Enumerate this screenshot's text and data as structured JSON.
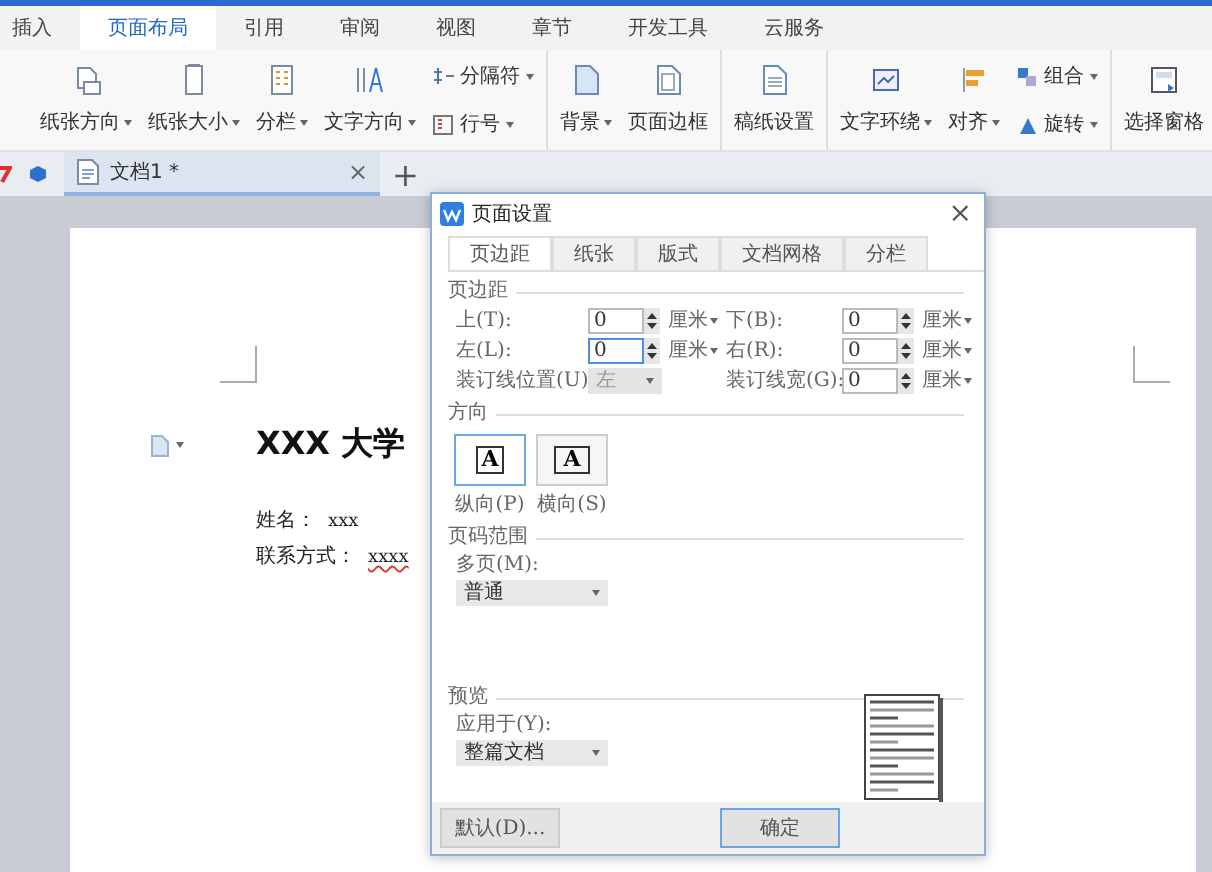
{
  "ribbon_tabs": [
    {
      "label": "插入",
      "selected": false
    },
    {
      "label": "页面布局",
      "selected": true
    },
    {
      "label": "引用",
      "selected": false
    },
    {
      "label": "审阅",
      "selected": false
    },
    {
      "label": "视图",
      "selected": false
    },
    {
      "label": "章节",
      "selected": false
    },
    {
      "label": "开发工具",
      "selected": false
    },
    {
      "label": "云服务",
      "selected": false
    }
  ],
  "ribbon_groups": [
    [
      {
        "kind": "large",
        "label": "纸张方向",
        "dropdown": true
      },
      {
        "kind": "large",
        "label": "纸张大小",
        "dropdown": true
      },
      {
        "kind": "large",
        "label": "分栏",
        "dropdown": true
      },
      {
        "kind": "large",
        "label": "文字方向",
        "dropdown": true
      },
      {
        "kind": "stack",
        "rows": [
          {
            "label": "分隔符",
            "dropdown": true
          },
          {
            "label": "行号",
            "dropdown": true
          }
        ]
      }
    ],
    [
      {
        "kind": "large",
        "label": "背景",
        "dropdown": true
      },
      {
        "kind": "large",
        "label": "页面边框",
        "dropdown": false
      }
    ],
    [
      {
        "kind": "large",
        "label": "稿纸设置",
        "dropdown": false
      }
    ],
    [
      {
        "kind": "large",
        "label": "文字环绕",
        "dropdown": true
      },
      {
        "kind": "large",
        "label": "对齐",
        "dropdown": true
      },
      {
        "kind": "stack",
        "rows": [
          {
            "label": "组合",
            "dropdown": true
          },
          {
            "label": "旋转",
            "dropdown": true
          }
        ]
      }
    ],
    [
      {
        "kind": "large",
        "label": "选择窗格",
        "dropdown": false
      }
    ]
  ],
  "doc_tabs": [
    {
      "label": "文档1 *",
      "selected": true,
      "close": "×"
    }
  ],
  "new_tab": "+",
  "document": {
    "heading": "XXX 大学",
    "lines": [
      {
        "label": "姓名：",
        "value": "xxx",
        "misspelled": false
      },
      {
        "label": "联系方式：",
        "value": "xxxx",
        "misspelled": true
      }
    ]
  },
  "dialog": {
    "title": "页面设置",
    "close": "×",
    "tabs": [
      {
        "label": "页边距",
        "selected": true
      },
      {
        "label": "纸张",
        "selected": false
      },
      {
        "label": "版式",
        "selected": false
      },
      {
        "label": "文档网格",
        "selected": false
      },
      {
        "label": "分栏",
        "selected": false
      }
    ],
    "margins": {
      "heading": "页边距",
      "rows": [
        [
          {
            "kind": "spin",
            "label": "上(T):",
            "value": "0",
            "unit": "厘米",
            "focused": false
          },
          {
            "kind": "spin",
            "label": "下(B):",
            "value": "0",
            "unit": "厘米",
            "focused": false
          }
        ],
        [
          {
            "kind": "spin",
            "label": "左(L):",
            "value": "0",
            "unit": "厘米",
            "focused": true
          },
          {
            "kind": "spin",
            "label": "右(R):",
            "value": "0",
            "unit": "厘米",
            "focused": false
          }
        ],
        [
          {
            "kind": "select",
            "label": "装订线位置(U)",
            "value": "左",
            "disabled": true
          },
          {
            "kind": "spin",
            "label": "装订线宽(G):",
            "value": "0",
            "unit": "厘米",
            "focused": false
          }
        ]
      ]
    },
    "orientation": {
      "heading": "方向",
      "options": [
        {
          "label": "纵向(P)",
          "glyph": "A",
          "selected": true
        },
        {
          "label": "横向(S)",
          "glyph": "A",
          "selected": false
        }
      ]
    },
    "page_range": {
      "heading": "页码范围",
      "label": "多页(M):",
      "value": "普通"
    },
    "preview": {
      "heading": "预览",
      "label": "应用于(Y):",
      "value": "整篇文档"
    },
    "buttons": [
      {
        "label": "默认(D)...",
        "default": false
      },
      {
        "label": "确定",
        "default": true
      }
    ]
  }
}
